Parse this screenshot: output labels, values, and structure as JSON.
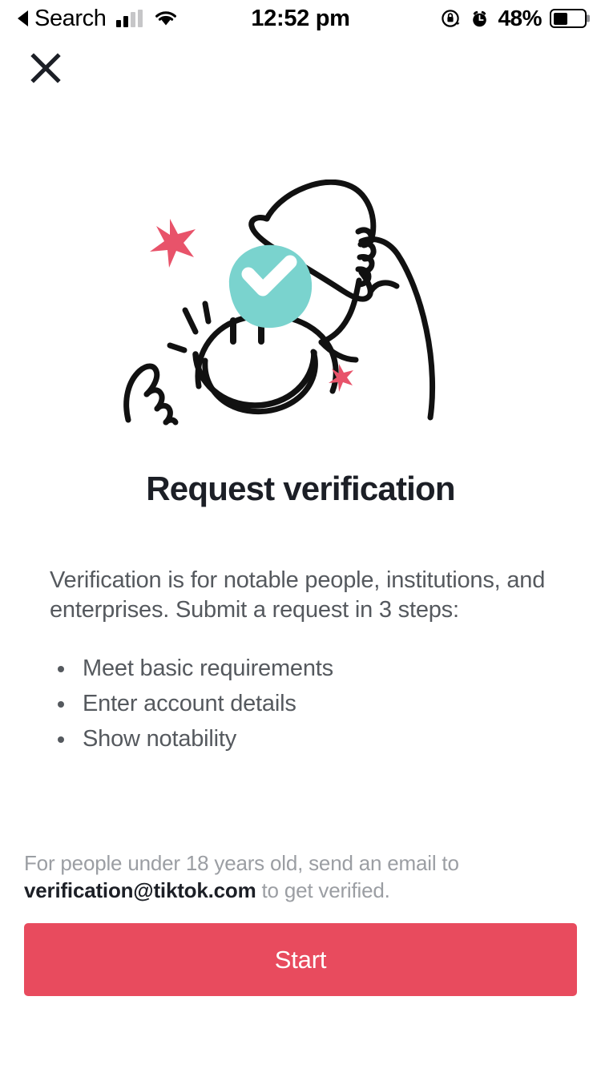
{
  "status_bar": {
    "back_arrow_icon": "triangle-left-icon",
    "carrier_label": "Search",
    "signal_icon": "cellular-signal-icon",
    "wifi_icon": "wifi-icon",
    "time": "12:52 pm",
    "rotation_lock_icon": "rotation-lock-icon",
    "alarm_icon": "alarm-clock-icon",
    "battery_percent": "48%",
    "battery_icon": "battery-icon",
    "battery_level": 48
  },
  "nav": {
    "close_icon": "close-icon"
  },
  "illustration": {
    "name": "verification-badge-illustration",
    "description": "Hand-drawn smiley face tipping a hat with a teal verified checkmark and pink stars",
    "check_circle_color": "#7ad3ce",
    "check_mark_color": "#ffffff",
    "star_color": "#e8536a",
    "line_color": "#111111"
  },
  "main": {
    "title": "Request verification",
    "intro": "Verification is for notable people, institutions, and enterprises. Submit a request in 3 steps:",
    "steps": [
      "Meet basic requirements",
      "Enter account details",
      "Show notability"
    ]
  },
  "footnote": {
    "prefix": "For people under 18 years old, send an email to ",
    "email": "verification@tiktok.com",
    "suffix": " to get verified."
  },
  "cta": {
    "label": "Start",
    "background_color": "#e84b5e",
    "text_color": "#ffffff"
  },
  "colors": {
    "accent": "#e84b5e",
    "teal": "#7ad3ce",
    "title": "#1c1f26",
    "body": "#55595e",
    "muted": "#9b9ea3",
    "background": "#ffffff"
  }
}
